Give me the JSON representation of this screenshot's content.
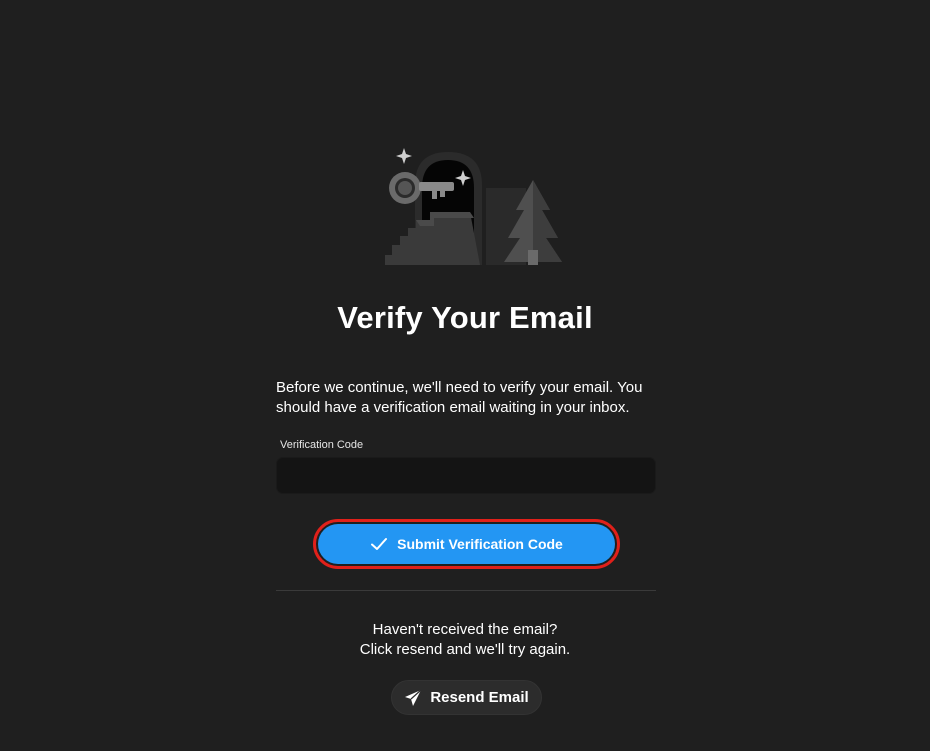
{
  "page": {
    "title": "Verify Your Email",
    "description": "Before we continue, we'll need to verify your email. You should have a verification email waiting in your inbox."
  },
  "verification": {
    "label": "Verification Code",
    "value": "",
    "placeholder": ""
  },
  "submit": {
    "label": "Submit Verification Code",
    "icon": "checkmark-icon",
    "color": "#2396f3",
    "highlight_color": "#e0201a"
  },
  "resend": {
    "line1": "Haven't received the email?",
    "line2": "Click resend and we'll try again.",
    "button_label": "Resend Email",
    "icon": "paper-plane-icon"
  },
  "illustration": {
    "icon": "key-door-illustration"
  },
  "colors": {
    "background": "#1f1f1f",
    "input_background": "#141414"
  }
}
